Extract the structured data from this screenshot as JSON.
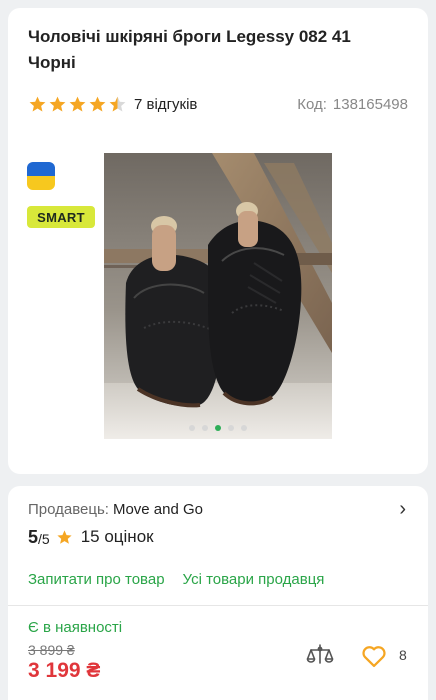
{
  "product": {
    "title": "Чоловічі шкіряні броги Legessy 082 41 Чорні",
    "rating": 4.5,
    "reviews_text": "7 відгуків",
    "code_label": "Код:",
    "code_value": "138165498"
  },
  "badges": {
    "flag": "ukraine-flag-icon",
    "smart": "SMART"
  },
  "gallery": {
    "image": "black leather brogue shoes",
    "dots_count": 5,
    "active_index": 2
  },
  "seller": {
    "label": "Продавець:",
    "name": "Move and Go",
    "score": "5",
    "score_max": "/5",
    "ratings_count": "15 оцінок",
    "ask_link": "Запитати про товар",
    "all_products_link": "Усі товари продавця"
  },
  "purchase": {
    "availability": "Є в наявності",
    "old_price": "3 899 ₴",
    "new_price": "3 199 ₴",
    "favorites_count": "8"
  },
  "colors": {
    "accent_green": "#2aa548",
    "price_red": "#e0363b",
    "star_yellow": "#f5a623"
  }
}
